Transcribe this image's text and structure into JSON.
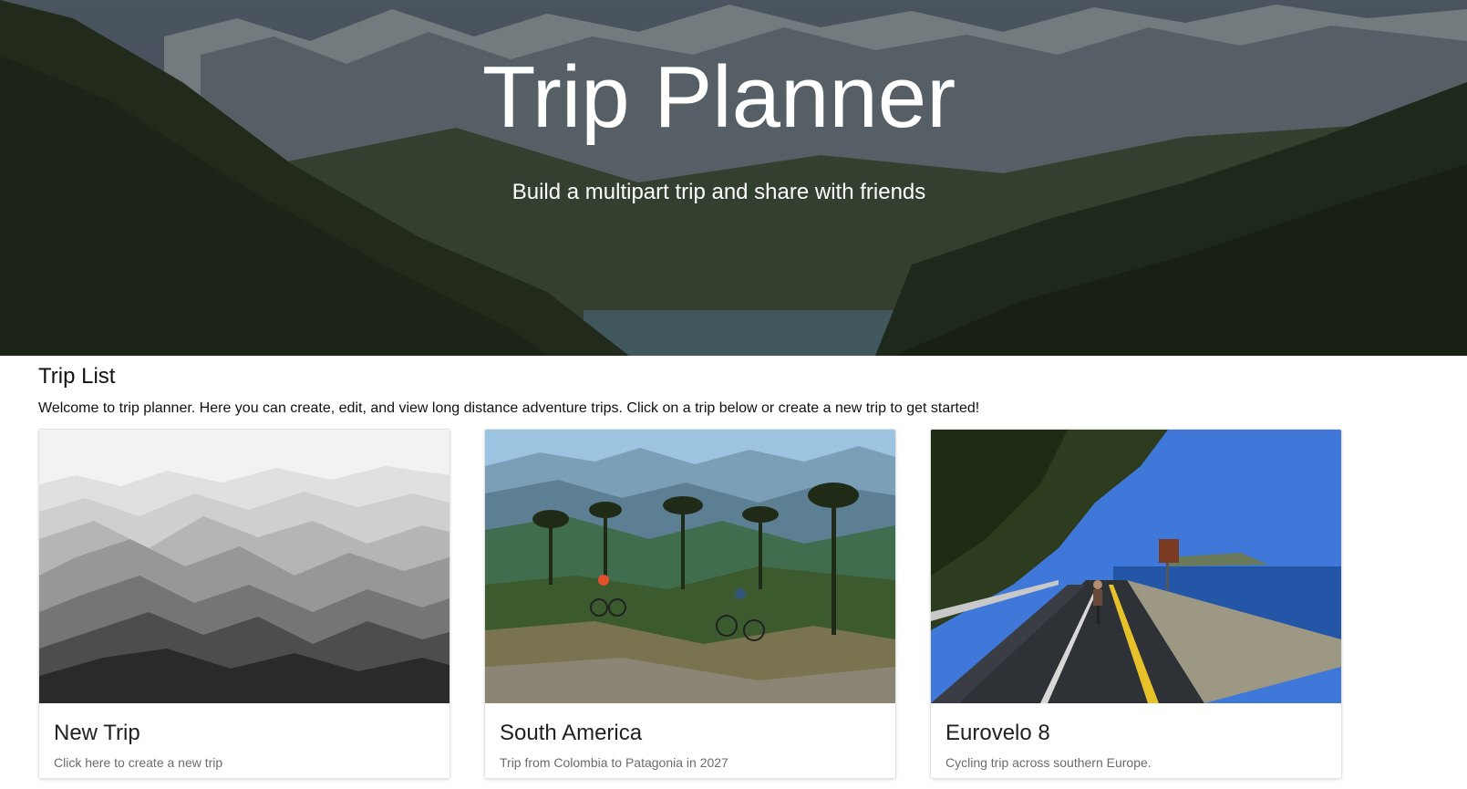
{
  "hero": {
    "title": "Trip Planner",
    "subtitle": "Build a multipart trip and share with friends"
  },
  "trip_list": {
    "title": "Trip List",
    "description": "Welcome to trip planner. Here you can create, edit, and view long distance adventure trips. Click on a trip below or create a new trip to get started!"
  },
  "cards": [
    {
      "title": "New Trip",
      "text": "Click here to create a new trip",
      "image": "mountain-silhouette-grayscale"
    },
    {
      "title": "South America",
      "text": "Trip from Colombia to Patagonia in 2027",
      "image": "mountain-bikers-araucaria-forest"
    },
    {
      "title": "Eurovelo 8",
      "text": "Cycling trip across southern Europe.",
      "image": "cyclist-coastal-road"
    }
  ]
}
